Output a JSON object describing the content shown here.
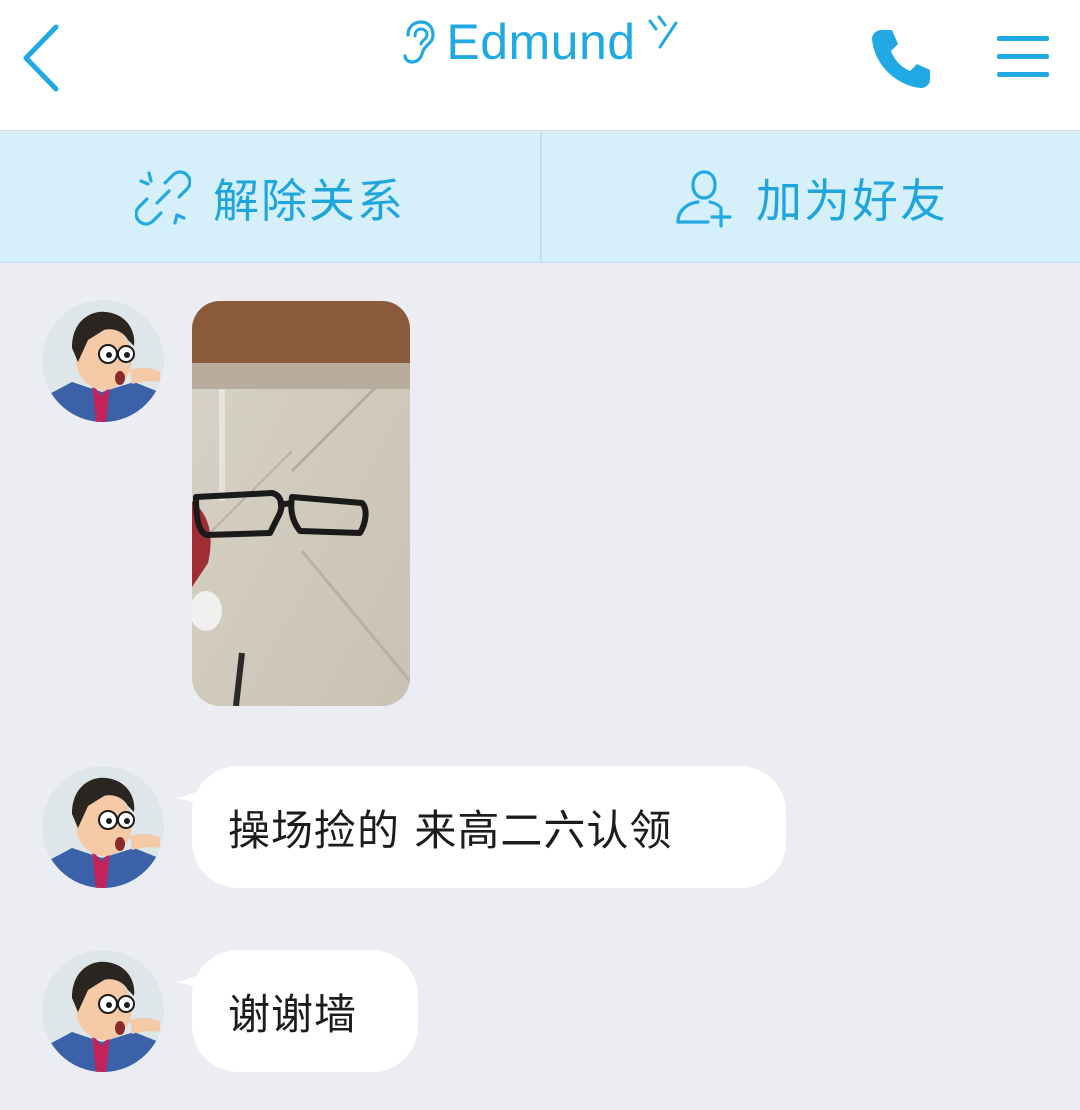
{
  "header": {
    "title": "Edmund",
    "icons": {
      "back": "chevron-left-icon",
      "ear": "ear-icon",
      "signal": "signal-icon",
      "call": "phone-icon",
      "menu": "hamburger-menu-icon"
    },
    "accent_color": "#21a9e4"
  },
  "actions": [
    {
      "label": "解除关系",
      "icon": "unlink-icon"
    },
    {
      "label": "加为好友",
      "icon": "add-friend-icon"
    }
  ],
  "messages": [
    {
      "type": "image",
      "content": "photo of black-framed glasses held over a tiled floor"
    },
    {
      "type": "text",
      "text": "操场捡的 来高二六认领"
    },
    {
      "type": "text",
      "text": "谢谢墙"
    }
  ]
}
